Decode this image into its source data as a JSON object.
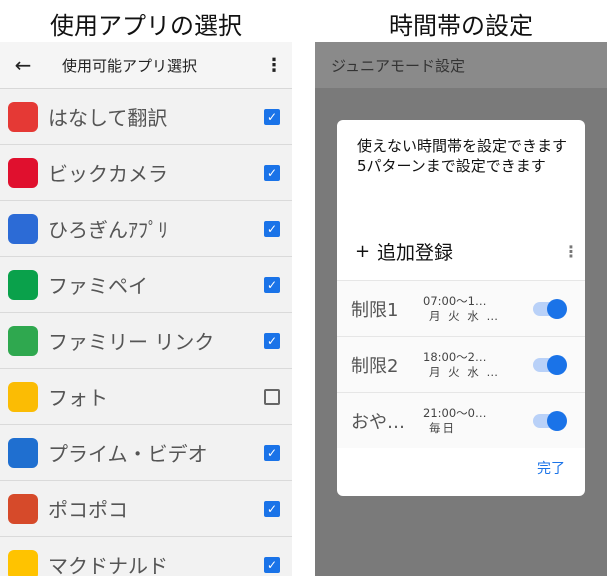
{
  "left_panel": {
    "caption": "使用アプリの選択",
    "appbar": {
      "back_icon": "←",
      "title": "使用可能アプリ選択",
      "menu_icon": "⋮"
    },
    "apps": [
      {
        "label": "はなして翻訳",
        "checked": true,
        "icon": "translate-icon",
        "color": "#e53935"
      },
      {
        "label": "ビックカメラ",
        "checked": true,
        "icon": "biccamera-icon",
        "color": "#e0102e"
      },
      {
        "label": "ひろぎんｱﾌﾟﾘ",
        "checked": true,
        "icon": "hirogin-icon",
        "color": "#2c6bd6"
      },
      {
        "label": "ファミペイ",
        "checked": true,
        "icon": "famipay-icon",
        "color": "#0aa14b"
      },
      {
        "label": "ファミリー リンク",
        "checked": true,
        "icon": "familylink-icon",
        "color": "#2fa84f"
      },
      {
        "label": "フォト",
        "checked": false,
        "icon": "photos-icon",
        "color": "#fbbc04"
      },
      {
        "label": "プライム・ビデオ",
        "checked": true,
        "icon": "primevideo-icon",
        "color": "#1f6fd0"
      },
      {
        "label": "ポコポコ",
        "checked": true,
        "icon": "pokopoko-icon",
        "color": "#d64a2a"
      },
      {
        "label": "マクドナルド",
        "checked": true,
        "icon": "mcdonalds-icon",
        "color": "#ffc300"
      }
    ]
  },
  "right_panel": {
    "caption": "時間帯の設定",
    "appbar_title": "ジュニアモード設定",
    "dialog": {
      "message": "使えない時間帯を設定できます\n5パターンまで設定できます",
      "add_icon": "+",
      "add_label": "追加登録",
      "menu_icon": "⋮",
      "limits": [
        {
          "name": "制限1",
          "time": "07:00～1…",
          "days": "月 火 水 …",
          "enabled": true
        },
        {
          "name": "制限2",
          "time": "18:00～2…",
          "days": "月 火 水 …",
          "enabled": true
        },
        {
          "name": "おや…",
          "time": "21:00～0…",
          "days": "毎日",
          "enabled": true
        }
      ],
      "done_label": "完了"
    }
  },
  "colors": {
    "accent": "#1a73e8",
    "dim_overlay": "#7a7a7a"
  }
}
